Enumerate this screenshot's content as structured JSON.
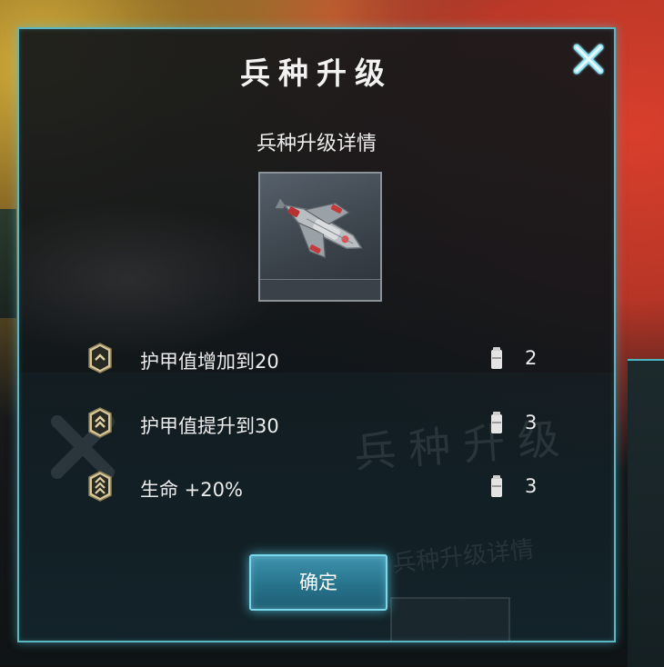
{
  "dialog": {
    "title": "兵种升级",
    "subtitle": "兵种升级详情",
    "close_icon": "close-x-icon",
    "unit_image": "starship-unit-image"
  },
  "upgrades": [
    {
      "rank_icon": "rank-chevron-1-icon",
      "label": "护甲值增加到20",
      "cost_icon": "resource-cylinder-icon",
      "cost": "2"
    },
    {
      "rank_icon": "rank-chevron-2-icon",
      "label": "护甲值提升到30",
      "cost_icon": "resource-cylinder-icon",
      "cost": "3"
    },
    {
      "rank_icon": "rank-chevron-3-icon",
      "label": "生命 +20%",
      "cost_icon": "resource-cylinder-icon",
      "cost": "3"
    }
  ],
  "confirm_label": "确定",
  "colors": {
    "accent_border": "#5fb6c3",
    "button_glow": "#79d8ea",
    "rank_gold": "#c9b98a",
    "text": "#ececec"
  }
}
